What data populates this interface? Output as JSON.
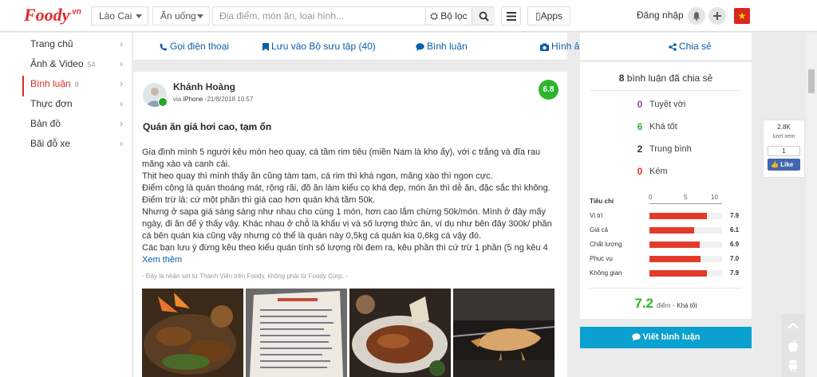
{
  "header": {
    "logo_text": "Foody",
    "logo_suffix": ".vn",
    "city": "Lào Cai",
    "category": "Ăn uống",
    "search_placeholder": "Địa điểm, món ăn, loại hình...",
    "filter_label": "Bộ lọc",
    "apps_label": "Apps",
    "login_label": "Đăng nhập",
    "flag_glyph": "★"
  },
  "sidebar": {
    "items": [
      {
        "label": "Trang chủ",
        "count": ""
      },
      {
        "label": "Ảnh & Video",
        "count": "54"
      },
      {
        "label": "Bình luận",
        "count": "8"
      },
      {
        "label": "Thực đơn",
        "count": ""
      },
      {
        "label": "Bản đồ",
        "count": ""
      },
      {
        "label": "Bãi đỗ xe",
        "count": ""
      }
    ],
    "active_index": 2
  },
  "actions": {
    "call": "Gọi điện thoại",
    "save": "Lưu vào Bộ sưu tập (40)",
    "comment": "Bình luận",
    "photos": "Hình ảnh",
    "share": "Chia sẻ"
  },
  "review": {
    "author": "Khánh Hoàng",
    "via_prefix": "via",
    "via_device": "iPhone",
    "date": "21/8/2018 10:57",
    "score": "6.8",
    "title": "Quán ăn giá hơi cao, tạm ổn",
    "lines": [
      "Gia đình mình 5 người kêu món heo quay, cá tầm rim tiêu (miền Nam là kho ẩy), với c trắng và đĩa rau",
      "măng xào và canh cải.",
      "Thịt heo quay thì mình thấy ăn cũng tàm tạm, cá rim thì khá ngon, măng xào thì ngon cực.",
      "Điểm cộng là quán thoáng mát, rộng rãi, đồ ăn làm kiểu cọ khá đẹp, món ăn thì dễ ăn, đặc sắc thì không.",
      "Điểm trừ là: cứ một phần thì giá cao hơn quán khá tầm 50k.",
      "Nhưng ở sapa giá sàng sàng như nhau cho cùng 1 món, hơn cao lắm chừng 50k/món. Mình ở đây mấy",
      "ngày, đi ăn để ý thấy vậy. Khác nhau ở chỗ là khẩu vị và số lượng thức ăn, ví dụ như bên đây 300k/ phần",
      "cá bên quán kia cũng vậy nhưng có thể là quán này 0,5kg cá quán kia 0,6kg cá vậy đó.",
      "Các bạn lưu ý đừng kêu theo kiểu quán tính số lượng rồi đem ra, kêu phần thì cứ trừ 1 phần (5 ng kêu 4"
    ],
    "more_label": "Xem thêm",
    "disclaimer": "- Đây là nhận xét từ Thành Viên trên Foody, không phải từ Foody Corp. -"
  },
  "summary": {
    "total_prefix": "8",
    "total_suffix": "bình luận đã chia sẻ",
    "levels": [
      {
        "count": "0",
        "label": "Tuyệt vời",
        "color": "#8e44ad"
      },
      {
        "count": "6",
        "label": "Khá tốt",
        "color": "#2db52d"
      },
      {
        "count": "2",
        "label": "Trung bình",
        "color": "#333333"
      },
      {
        "count": "0",
        "label": "Kém",
        "color": "#e02b27"
      }
    ],
    "criteria_header": "Tiêu chí",
    "scale_ticks": [
      "0",
      "5",
      "10"
    ],
    "criteria": [
      {
        "label": "Vị trí",
        "value": "7.9",
        "score": 7.9
      },
      {
        "label": "Giá cả",
        "value": "6.1",
        "score": 6.1
      },
      {
        "label": "Chất lượng",
        "value": "6.9",
        "score": 6.9
      },
      {
        "label": "Phục vụ",
        "value": "7.0",
        "score": 7.0
      },
      {
        "label": "Không gian",
        "value": "7.9",
        "score": 7.9
      }
    ],
    "average": "7.2",
    "average_unit": "điểm",
    "average_label": "- Khá tốt",
    "write_button": "Viết bình luận"
  },
  "like_widget": {
    "count": "2.8K",
    "label": "lượt xem",
    "bubble": "1",
    "button": "Like"
  },
  "colors": {
    "brand_red": "#e02b27",
    "link_blue": "#0b5ea9",
    "score_green": "#2db52d",
    "bar_red": "#e23b2a",
    "cta_blue": "#0aa0cf"
  }
}
